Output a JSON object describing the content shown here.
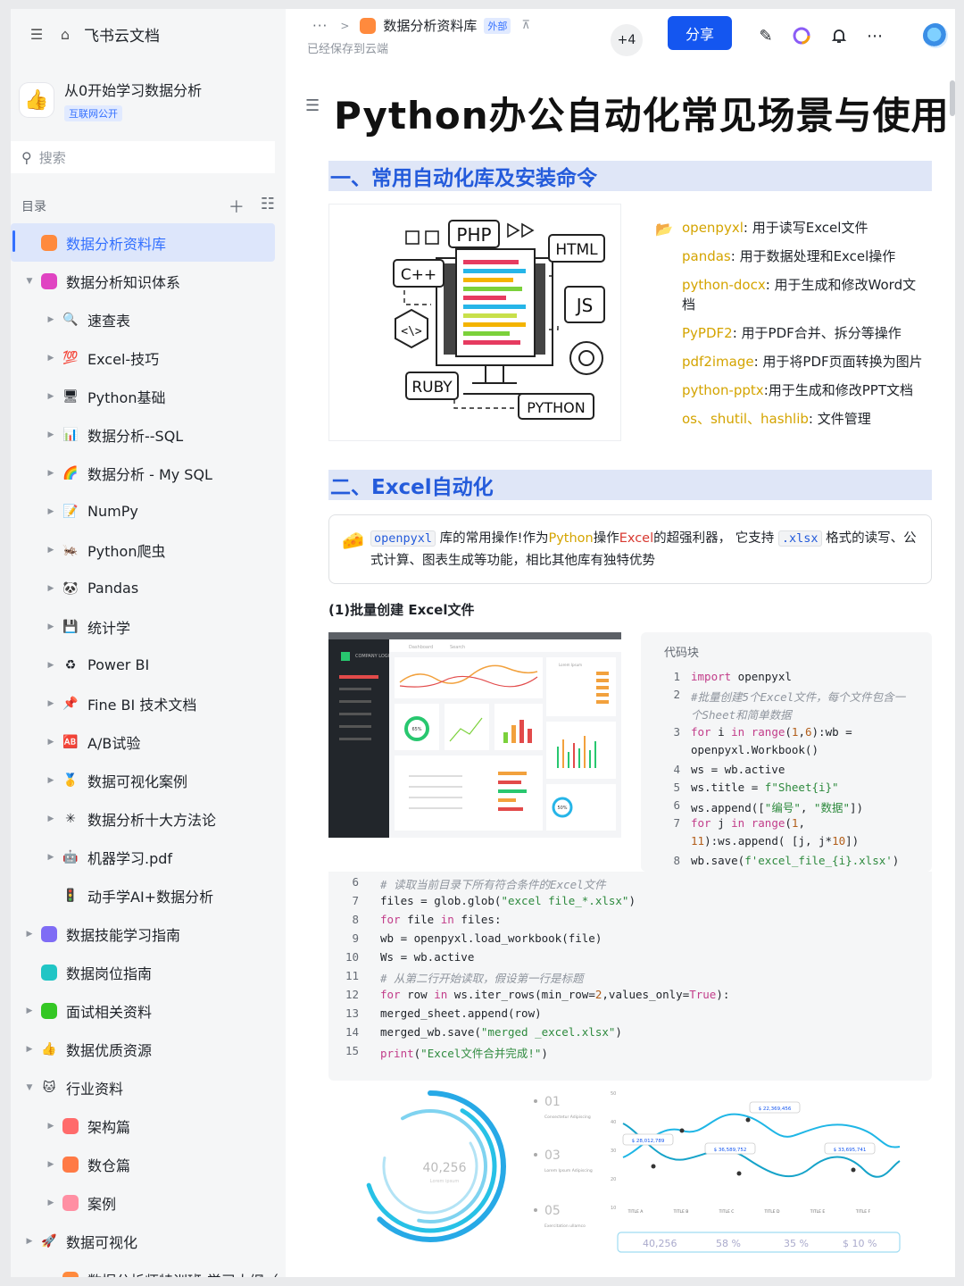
{
  "sidebar": {
    "brand": "飞书云文档",
    "workspace": {
      "name": "从0开始学习数据分析",
      "tag": "互联网公开"
    },
    "search_placeholder": "搜索",
    "toc_label": "目录",
    "items": [
      {
        "label": "数据分析资料库",
        "level": 0,
        "arrow": "",
        "color": "#ff8a3d",
        "emoji": "",
        "active": true
      },
      {
        "label": "数据分析知识体系",
        "level": 0,
        "arrow": "▼",
        "color": "#e043c2",
        "emoji": ""
      },
      {
        "label": "速查表",
        "level": 1,
        "arrow": "▶",
        "color": "",
        "emoji": "🔍"
      },
      {
        "label": "Excel-技巧",
        "level": 1,
        "arrow": "▶",
        "color": "",
        "emoji": "💯"
      },
      {
        "label": "Python基础",
        "level": 1,
        "arrow": "▶",
        "color": "",
        "emoji": "🖥"
      },
      {
        "label": "数据分析--SQL",
        "level": 1,
        "arrow": "▶",
        "color": "",
        "emoji": "📊"
      },
      {
        "label": "数据分析 - My SQL",
        "level": 1,
        "arrow": "▶",
        "color": "",
        "emoji": "🌈"
      },
      {
        "label": "NumPy",
        "level": 1,
        "arrow": "▶",
        "color": "",
        "emoji": "📝"
      },
      {
        "label": "Python爬虫",
        "level": 1,
        "arrow": "▶",
        "color": "",
        "emoji": "🦗"
      },
      {
        "label": "Pandas",
        "level": 1,
        "arrow": "▶",
        "color": "",
        "emoji": "🐼"
      },
      {
        "label": "统计学",
        "level": 1,
        "arrow": "▶",
        "color": "",
        "emoji": "💾"
      },
      {
        "label": "Power BI",
        "level": 1,
        "arrow": "▶",
        "color": "",
        "emoji": "♻"
      },
      {
        "label": "Fine BI 技术文档",
        "level": 1,
        "arrow": "▶",
        "color": "",
        "emoji": "📌"
      },
      {
        "label": "A/B试验",
        "level": 1,
        "arrow": "▶",
        "color": "",
        "emoji": "🆎"
      },
      {
        "label": "数据可视化案例",
        "level": 1,
        "arrow": "▶",
        "color": "",
        "emoji": "🥇"
      },
      {
        "label": "数据分析十大方法论",
        "level": 1,
        "arrow": "▶",
        "color": "",
        "emoji": "✳"
      },
      {
        "label": "机器学习.pdf",
        "level": 1,
        "arrow": "▶",
        "color": "",
        "emoji": "🤖"
      },
      {
        "label": "动手学AI+数据分析",
        "level": 1,
        "arrow": "",
        "color": "",
        "emoji": "🚦"
      },
      {
        "label": "数据技能学习指南",
        "level": 0,
        "arrow": "▶",
        "color": "#7f6cf5",
        "emoji": ""
      },
      {
        "label": "数据岗位指南",
        "level": 0,
        "arrow": "",
        "color": "#20c5c5",
        "emoji": ""
      },
      {
        "label": "面试相关资料",
        "level": 0,
        "arrow": "▶",
        "color": "#34c724",
        "emoji": ""
      },
      {
        "label": "数据优质资源",
        "level": 0,
        "arrow": "▶",
        "color": "",
        "emoji": "👍"
      },
      {
        "label": "行业资料",
        "level": 0,
        "arrow": "▼",
        "color": "",
        "emoji": "🐱"
      },
      {
        "label": "架构篇",
        "level": 1,
        "arrow": "▶",
        "color": "#ff6b6b",
        "emoji": ""
      },
      {
        "label": "数仓篇",
        "level": 1,
        "arrow": "▶",
        "color": "#ff7a45",
        "emoji": ""
      },
      {
        "label": "案例",
        "level": 1,
        "arrow": "▶",
        "color": "#ff8fa3",
        "emoji": ""
      },
      {
        "label": "数据可视化",
        "level": 0,
        "arrow": "▶",
        "color": "",
        "emoji": "🚀"
      },
      {
        "label": "数据分析师特训班-学习大纲（",
        "level": 1,
        "arrow": "",
        "color": "#ff8a3d",
        "emoji": ""
      }
    ]
  },
  "header": {
    "breadcrumb": "数据分析资料库",
    "external_tag": "外部",
    "saved": "已经保存到云端",
    "collaborators": "+4",
    "share": "分享"
  },
  "doc": {
    "title": "Python办公自动化常见场景与使用",
    "section1": "一、常用自动化库及安装命令",
    "tech_logo_labels": [
      "PHP",
      "HTML",
      "C++",
      "JS",
      "RUBY",
      "PYTHON"
    ],
    "libs": [
      {
        "name": "openpyxl",
        "desc": ": 用于读写Excel文件"
      },
      {
        "name": "pandas",
        "desc": ": 用于数据处理和Excel操作"
      },
      {
        "name": "python-docx",
        "desc": ": 用于生成和修改Word文档"
      },
      {
        "name": "PyPDF2",
        "desc": ": 用于PDF合并、拆分等操作"
      },
      {
        "name": "pdf2image",
        "desc": ": 用于将PDF页面转换为图片"
      },
      {
        "name": "python-pptx",
        "desc": ":用于生成和修改PPT文档"
      },
      {
        "name": "os、shutil、hashlib",
        "desc": ": 文件管理"
      }
    ],
    "section2": "二、Excel自动化",
    "callout": {
      "code1": "openpyxl",
      "t1": "库的常用操作!作为",
      "py": "Python",
      "t2": "操作",
      "xl": "Excel",
      "t3": "的超强利器， 它支持",
      "code2": ".xlsx",
      "t4": "格式的读写、公式计算、图表生成等功能，相比其他库有独特优势"
    },
    "subheading": "(1)批量创建 Excel文件",
    "code_label": "代码块",
    "dashboard": {
      "logo": "COMPANY LOGO",
      "dashboard_label": "Dashboard",
      "search": "Search",
      "card_title": "Lorem Ipsum",
      "gauge": "65%",
      "gauge2": "50%"
    },
    "infographic": {
      "center_value": "40,256",
      "center_sub": "Lorem ipsum",
      "steps": [
        {
          "num": "01",
          "text": "Consectetur Adipiscing"
        },
        {
          "num": "03",
          "text": "Lorem Ipsum Adipiscing"
        },
        {
          "num": "05",
          "text": "Exercitation ullamco"
        }
      ],
      "callouts": [
        "$ 22,369,456",
        "$ 28,012,789",
        "$ 36,589,752",
        "$ 33,695,741"
      ],
      "y_ticks": [
        "50",
        "40",
        "30",
        "20",
        "10"
      ],
      "x_labels": [
        "TITLE A",
        "TITLE B",
        "TITLE C",
        "TITLE D",
        "TITLE E",
        "TITLE F"
      ],
      "footer": [
        "40,256",
        "58 %",
        "35 %",
        "$ 10 %"
      ]
    }
  }
}
